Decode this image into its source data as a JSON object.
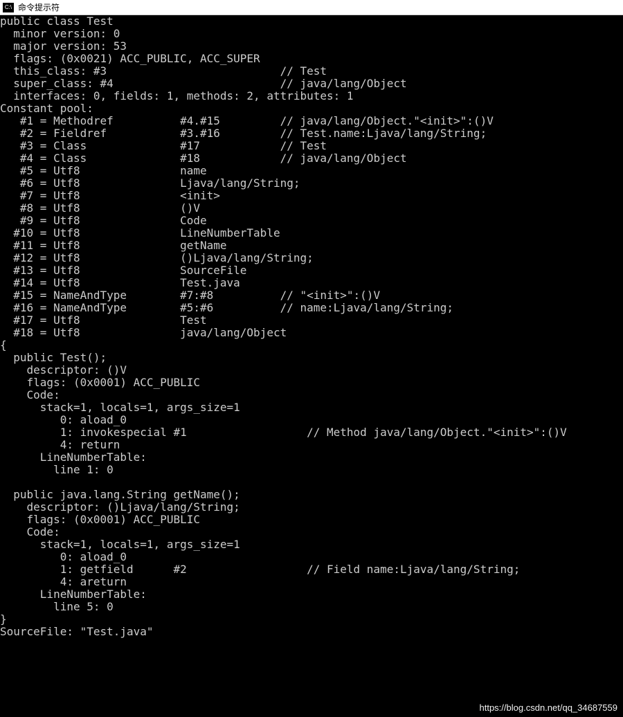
{
  "window": {
    "icon_label": "C:\\",
    "title": "命令提示符"
  },
  "terminal": {
    "lines": [
      "public class Test",
      "  minor version: 0",
      "  major version: 53",
      "  flags: (0x0021) ACC_PUBLIC, ACC_SUPER",
      "  this_class: #3                          // Test",
      "  super_class: #4                         // java/lang/Object",
      "  interfaces: 0, fields: 1, methods: 2, attributes: 1",
      "Constant pool:",
      "   #1 = Methodref          #4.#15         // java/lang/Object.\"<init>\":()V",
      "   #2 = Fieldref           #3.#16         // Test.name:Ljava/lang/String;",
      "   #3 = Class              #17            // Test",
      "   #4 = Class              #18            // java/lang/Object",
      "   #5 = Utf8               name",
      "   #6 = Utf8               Ljava/lang/String;",
      "   #7 = Utf8               <init>",
      "   #8 = Utf8               ()V",
      "   #9 = Utf8               Code",
      "  #10 = Utf8               LineNumberTable",
      "  #11 = Utf8               getName",
      "  #12 = Utf8               ()Ljava/lang/String;",
      "  #13 = Utf8               SourceFile",
      "  #14 = Utf8               Test.java",
      "  #15 = NameAndType        #7:#8          // \"<init>\":()V",
      "  #16 = NameAndType        #5:#6          // name:Ljava/lang/String;",
      "  #17 = Utf8               Test",
      "  #18 = Utf8               java/lang/Object",
      "{",
      "  public Test();",
      "    descriptor: ()V",
      "    flags: (0x0001) ACC_PUBLIC",
      "    Code:",
      "      stack=1, locals=1, args_size=1",
      "         0: aload_0",
      "         1: invokespecial #1                  // Method java/lang/Object.\"<init>\":()V",
      "         4: return",
      "      LineNumberTable:",
      "        line 1: 0",
      "",
      "  public java.lang.String getName();",
      "    descriptor: ()Ljava/lang/String;",
      "    flags: (0x0001) ACC_PUBLIC",
      "    Code:",
      "      stack=1, locals=1, args_size=1",
      "         0: aload_0",
      "         1: getfield      #2                  // Field name:Ljava/lang/String;",
      "         4: areturn",
      "      LineNumberTable:",
      "        line 5: 0",
      "}",
      "SourceFile: \"Test.java\""
    ]
  },
  "watermark": "https://blog.csdn.net/qq_34687559"
}
